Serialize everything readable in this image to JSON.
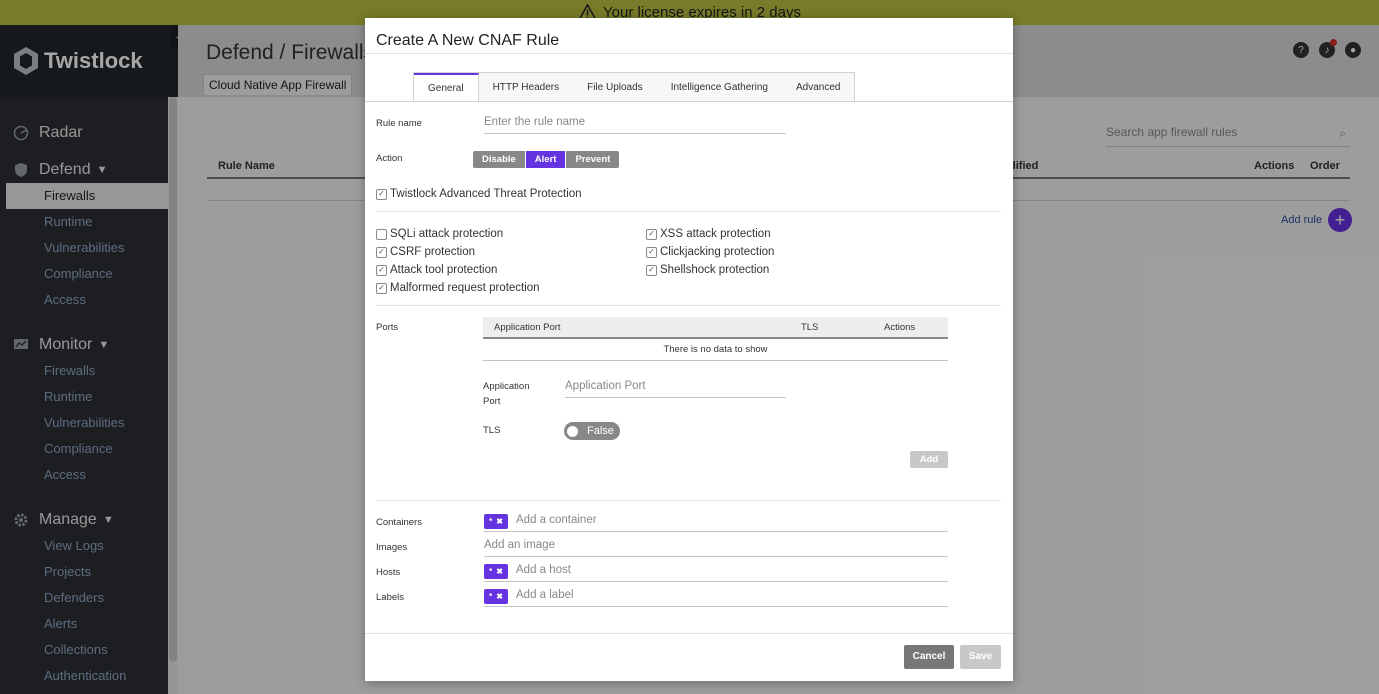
{
  "banner": {
    "text": "Your license expires in 2 days"
  },
  "app": {
    "logo_text": "Twistlock",
    "collapse_glyph": "◀"
  },
  "sidebar": {
    "sections": [
      {
        "label": "Radar",
        "icon": "radar-icon",
        "items": []
      },
      {
        "label": "Defend",
        "icon": "shield-icon",
        "items": [
          "Firewalls",
          "Runtime",
          "Vulnerabilities",
          "Compliance",
          "Access"
        ]
      },
      {
        "label": "Monitor",
        "icon": "monitor-icon",
        "items": [
          "Firewalls",
          "Runtime",
          "Vulnerabilities",
          "Compliance",
          "Access"
        ]
      },
      {
        "label": "Manage",
        "icon": "gear-icon",
        "items": [
          "View Logs",
          "Projects",
          "Defenders",
          "Alerts",
          "Collections",
          "Authentication"
        ]
      }
    ],
    "active_item": "Defend/Firewalls"
  },
  "page": {
    "title": "Defend / Firewalls",
    "tab": "Cloud Native App Firewall",
    "search_placeholder": "Search app firewall rules",
    "table_headers": {
      "rule_name": "Rule Name",
      "modified": "dified",
      "actions": "Actions",
      "order": "Order"
    },
    "add_rule": "Add rule"
  },
  "modal": {
    "title": "Create A New CNAF Rule",
    "tabs": [
      "General",
      "HTTP Headers",
      "File Uploads",
      "Intelligence Gathering",
      "Advanced"
    ],
    "active_tab": "General",
    "rule_name": {
      "label": "Rule name",
      "placeholder": "Enter the rule name"
    },
    "action": {
      "label": "Action",
      "options": [
        "Disable",
        "Alert",
        "Prevent"
      ],
      "selected": "Alert"
    },
    "advanced_threat": {
      "label": "Twistlock Advanced Threat Protection",
      "checked": true
    },
    "protections": [
      {
        "label": "SQLi attack protection",
        "checked": false
      },
      {
        "label": "XSS attack protection",
        "checked": true
      },
      {
        "label": "CSRF protection",
        "checked": true
      },
      {
        "label": "Clickjacking protection",
        "checked": true
      },
      {
        "label": "Attack tool protection",
        "checked": true
      },
      {
        "label": "Shellshock protection",
        "checked": true
      },
      {
        "label": "Malformed request protection",
        "checked": true
      }
    ],
    "ports": {
      "label": "Ports",
      "headers": [
        "Application Port",
        "TLS",
        "Actions"
      ],
      "empty_text": "There is no data to show",
      "app_port_label_1": "Application",
      "app_port_label_2": "Port",
      "app_port_placeholder": "Application Port",
      "tls_label": "TLS",
      "tls_value": "False",
      "add_button": "Add"
    },
    "scope": {
      "containers": {
        "label": "Containers",
        "placeholder": "Add a container",
        "chip": "*"
      },
      "images": {
        "label": "Images",
        "placeholder": "Add an image"
      },
      "hosts": {
        "label": "Hosts",
        "placeholder": "Add a host",
        "chip": "*"
      },
      "labels": {
        "label": "Labels",
        "placeholder": "Add a label",
        "chip": "*"
      }
    },
    "cancel": "Cancel",
    "save": "Save"
  },
  "colors": {
    "accent": "#6434e0",
    "banner": "#b8bd3f",
    "sidebar": "#2b2f33"
  }
}
